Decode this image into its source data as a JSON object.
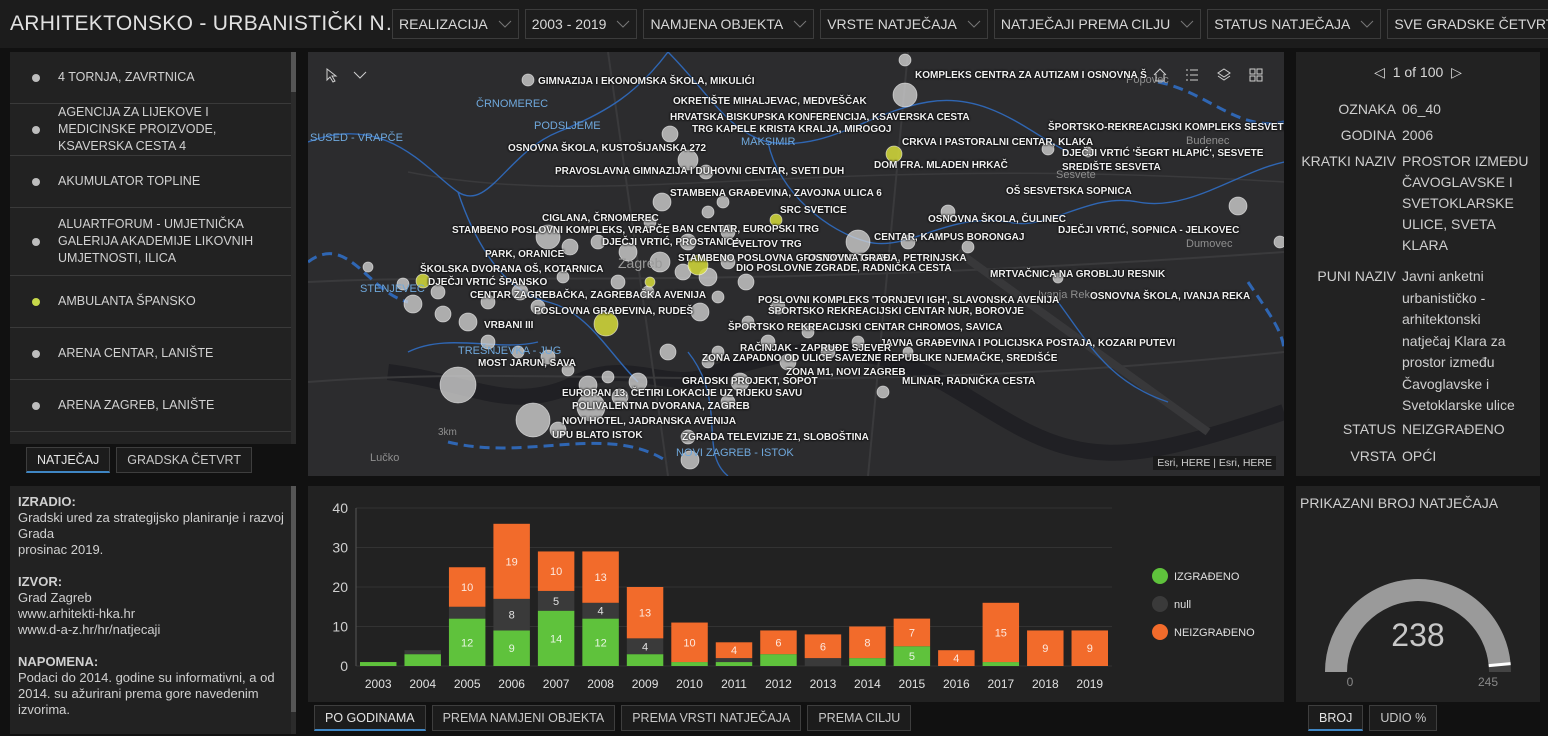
{
  "header": {
    "title": "ARHITEKTONSKO - URBANISTIČKI N…",
    "filters": [
      "REALIZACIJA",
      "2003 - 2019",
      "NAMJENA OBJEKTA",
      "VRSTE NATJEČAJA",
      "NATJEČAJI PREMA CILJU",
      "STATUS NATJEČAJA",
      "SVE GRADSKE ČETVRTI"
    ]
  },
  "list": {
    "items": [
      {
        "label": "4 TORNJA, ZAVRTNICA",
        "dot": "#bdbdbd"
      },
      {
        "label": "AGENCIJA ZA LIJEKOVE I MEDICINSKE PROIZVODE, KSAVERSKA CESTA 4",
        "dot": "#bdbdbd"
      },
      {
        "label": "AKUMULATOR TOPLINE",
        "dot": "#bdbdbd"
      },
      {
        "label": "ALUARTFORUM - UMJETNIČKA GALERIJA AKADEMIJE LIKOVNIH UMJETNOSTI, ILICA",
        "dot": "#bdbdbd"
      },
      {
        "label": "AMBULANTA ŠPANSKO",
        "dot": "#c6d84a"
      },
      {
        "label": "ARENA CENTAR, LANIŠTE",
        "dot": "#bdbdbd"
      },
      {
        "label": "ARENA ZAGREB, LANIŠTE",
        "dot": "#bdbdbd"
      }
    ],
    "tabs": [
      "NATJEČAJ",
      "GRADSKA ČETVRT"
    ]
  },
  "map": {
    "attribution": "Esri, HERE | Esri, HERE",
    "area_labels": [
      {
        "text": "ČRNOMEREC"
      },
      {
        "text": "PODSLJEME"
      },
      {
        "text": "SUSED - VRAPČE"
      },
      {
        "text": "MAKSIMIR"
      },
      {
        "text": "STENJEVEC"
      },
      {
        "text": "TREŠNJEVKA - JUG"
      },
      {
        "text": "NOVI ZAGREB - ISTOK"
      }
    ],
    "place_labels": [
      "Budenec",
      "Sesvete",
      "Dumovec",
      "Lučko",
      "Zagreb",
      "Ivanja Reka",
      "Popovec",
      "3km"
    ],
    "labels": [
      "GIMNAZIJA I EKONOMSKA ŠKOLA, MIKULIĆI",
      "KOMPLEKS CENTRA ZA AUTIZAM I OSNOVNA Š",
      "OKRETIŠTE MIHALJEVAC, MEDVEŠČAK",
      "HRVATSKA BISKUPSKA KONFERENCIJA, KSAVERSKA CESTA",
      "TRG KAPELE KRISTA KRALJA, MIROGOJ",
      "ŠPORTSKO-REKREACIJSKI KOMPLEKS SESVETE",
      "CRKVA I PASTORALNI CENTAR, KLAKA",
      "OSNOVNA ŠKOLA, KUSTOŠIJANSKA 272",
      "DJEČJI VRTIĆ 'ŠEGRT HLAPIĆ', SESVETE",
      "DOM FRA. MLADEN HRKAČ",
      "SREDIŠTE SESVETA",
      "PRAVOSLAVNA GIMNAZIJA I DUHOVNI CENTAR, SVETI DUH",
      "STAMBENA GRAĐEVINA, ZAVOJNA ULICA 6",
      "OŠ SESVETSKA SOPNICA",
      "SRC SVETICE",
      "CIGLANA, ČRNOMEREC",
      "OSNOVNA ŠKOLA, ČULINEC",
      "STAMBENO POSLOVNI KOMPLEKS, VRAPČE",
      "BAN CENTAR, EUROPSKI TRG",
      "DJEČJI VRTIĆ, SOPNICA - JELKOVEC",
      "CENTAR, KAMPUS BORONGAJ",
      "DJEČJI VRTIĆ, PROSTANICA",
      "EVELTOV TRG",
      "PARK, ORANICE",
      "STAMBENO POSLOVNA GRAĐEVINA TRNJE",
      "OSNOVNA GRAĐA, PETRINJSKA",
      "ŠKOLSKA DVORANA OŠ, KOTARNICA",
      "DIO POSLOVNE ZGRADE, RADNIČKA CESTA",
      "MRTVAČNICA NA GROBLJU RESNIK",
      "DJEČJI VRTIĆ ŠPANSKO",
      "OSNOVNA ŠKOLA, IVANJA REKA",
      "CENTAR ZAGREBAČKA, ZAGREBAČKA AVENIJA",
      "POSLOVNI KOMPLEKS 'TORNJEVI IGH', SLAVONSKA AVENIJA",
      "POSLOVNA GRAĐEVINA, RUDEŠ",
      "ŠPORTSKO REKREACIJSKI CENTAR NUR, BOROVJE",
      "VRBANI III",
      "ŠPORTSKO REKREACIJSKI CENTAR CHROMOS, SAVICA",
      "JAVNA GRAĐEVINA I POLICIJSKA POSTAJA, KOZARI PUTEVI",
      "RAČINJAK - ZAPRUĐE SJEVER",
      "ZONA ZAPADNO OD ULICE SAVEZNE REPUBLIKE NJEMAČKE, SREDIŠĆE",
      "MOST JARUN, SAVA",
      "ZONA M1, NOVI ZAGREB",
      "MLINAR, RADNIČKA CESTA",
      "GRADSKI PROJEKT, SOPOT",
      "EUROPAN 13, ČETIRI LOKACIJE UZ RIJEKU SAVU",
      "POLIVALENTNA DVORANA, ZAGREB",
      "NOVI HOTEL, JADRANSKA AVENIJA",
      "UPU BLATO ISTOK",
      "ZGRADA TELEVIZIJE Z1, SLOBOŠTINA"
    ]
  },
  "details": {
    "pager": "1 of 100",
    "fields": [
      {
        "key": "OZNAKA",
        "value": "06_40"
      },
      {
        "key": "GODINA",
        "value": "2006"
      },
      {
        "key": "KRATKI NAZIV",
        "value": "PROSTOR IZMEĐU ČAVOGLAVSKE I SVETOKLARSKE ULICE, SVETA KLARA"
      },
      {
        "key": "PUNI NAZIV",
        "value": "Javni anketni urbanističko - arhitektonski natječaj Klara za prostor između Čavoglavske i Svetoklarske ulice"
      },
      {
        "key": "STATUS",
        "value": "NEIZGRAĐENO"
      },
      {
        "key": "VRSTA",
        "value": "OPĆI"
      }
    ]
  },
  "notes": {
    "izradio_h": "IZRADIO:",
    "izradio": "Gradski ured za strategijsko planiranje i razvoj Grada",
    "izradio_date": "prosinac 2019.",
    "izvor_h": "IZVOR:",
    "izvor_1": "Grad Zagreb",
    "izvor_2": "www.arhitekti-hka.hr",
    "izvor_3": "www.d-a-z.hr/hr/natjecaji",
    "napomena_h": "NAPOMENA:",
    "napomena": "Podaci do 2014. godine su informativni, a od 2014. su ažurirani prema gore navedenim izvorima."
  },
  "chart_tabs": [
    "PO GODINAMA",
    "PREMA NAMJENI OBJEKTA",
    "PREMA VRSTI NATJEČAJA",
    "PREMA CILJU"
  ],
  "chart_data": {
    "type": "bar",
    "stacked": true,
    "categories": [
      "2003",
      "2004",
      "2005",
      "2006",
      "2007",
      "2008",
      "2009",
      "2010",
      "2011",
      "2012",
      "2013",
      "2014",
      "2015",
      "2016",
      "2017",
      "2018",
      "2019"
    ],
    "series": [
      {
        "name": "IZGRAĐENO",
        "color": "#5fc23c",
        "values": [
          1,
          3,
          12,
          9,
          14,
          12,
          3,
          1,
          1,
          3,
          0,
          2,
          5,
          0,
          1,
          0,
          0
        ]
      },
      {
        "name": "null",
        "color": "#3a3a3a",
        "values": [
          0,
          1,
          3,
          8,
          5,
          4,
          4,
          0,
          1,
          0,
          2,
          0,
          0,
          0,
          0,
          0,
          0
        ]
      },
      {
        "name": "NEIZGRAĐENO",
        "color": "#f26b2b",
        "values": [
          0,
          0,
          10,
          19,
          10,
          13,
          13,
          10,
          4,
          6,
          6,
          8,
          7,
          4,
          15,
          9,
          9
        ]
      }
    ],
    "labels": {
      "IZGRAĐENO": [
        "",
        "",
        "12",
        "9",
        "14",
        "12",
        "",
        "",
        "",
        "",
        "",
        "",
        "5",
        "",
        "",
        "",
        ""
      ],
      "null": [
        "",
        "",
        "",
        "8",
        "5",
        "4",
        "4",
        "",
        "",
        "",
        "",
        "",
        "",
        "",
        "",
        "",
        ""
      ],
      "NEIZGRAĐENO": [
        "",
        "",
        "10",
        "19",
        "10",
        "13",
        "13",
        "10",
        "4",
        "6",
        "6",
        "8",
        "7",
        "4",
        "15",
        "9",
        "9"
      ]
    },
    "ylim": [
      0,
      40
    ],
    "yticks": [
      0,
      10,
      20,
      30,
      40
    ],
    "legend": "right"
  },
  "gauge": {
    "title": "PRIKAZANI BROJ NATJEČAJA",
    "value": "238",
    "min": "0",
    "max": "245",
    "fraction": 0.9714,
    "tabs": [
      "BROJ",
      "UDIO %"
    ]
  }
}
